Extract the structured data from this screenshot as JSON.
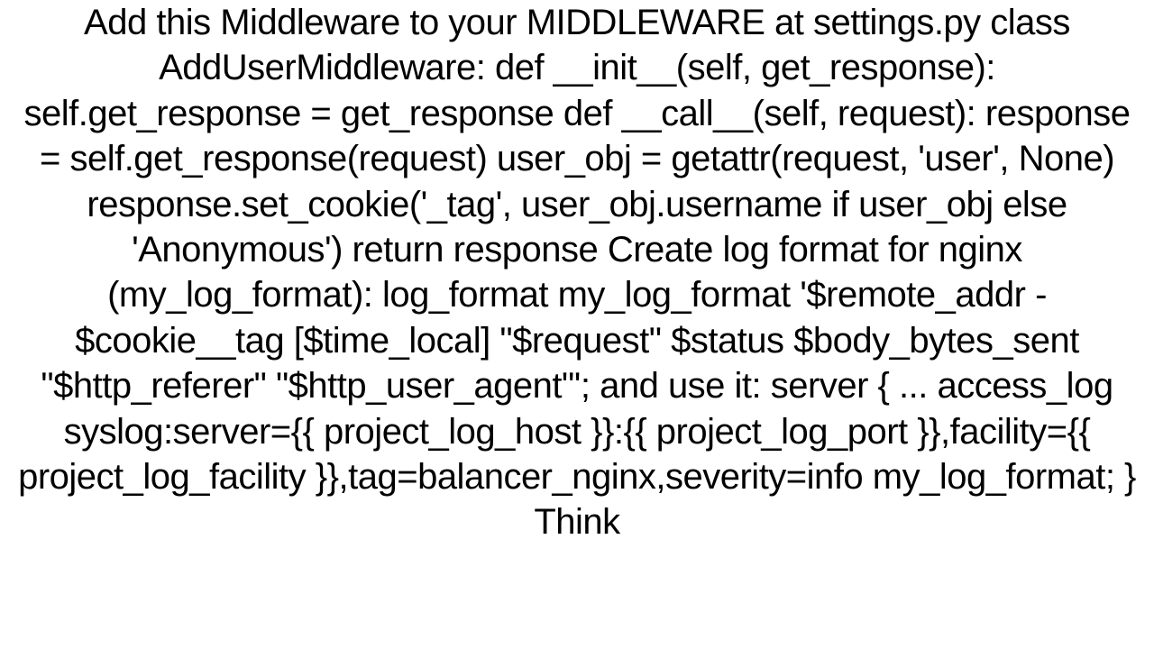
{
  "document": {
    "text": "Add this Middleware to your MIDDLEWARE at settings.py class AddUserMiddleware:     def __init__(self, get_response):         self.get_response = get_response      def __call__(self, request):         response = self.get_response(request)         user_obj = getattr(request, 'user', None)         response.set_cookie('_tag', user_obj.username if user_obj else 'Anonymous')         return response  Create log format for nginx (my_log_format): log_format my_log_format '$remote_addr - $cookie__tag [$time_local] \"$request\" $status $body_bytes_sent \"$http_referer\" \"$http_user_agent\"';  and use it: server {     ...     access_log syslog:server={{ project_log_host }}:{{ project_log_port }},facility={{ project_log_facility }},tag=balancer_nginx,severity=info my_log_format; }  Think"
  }
}
